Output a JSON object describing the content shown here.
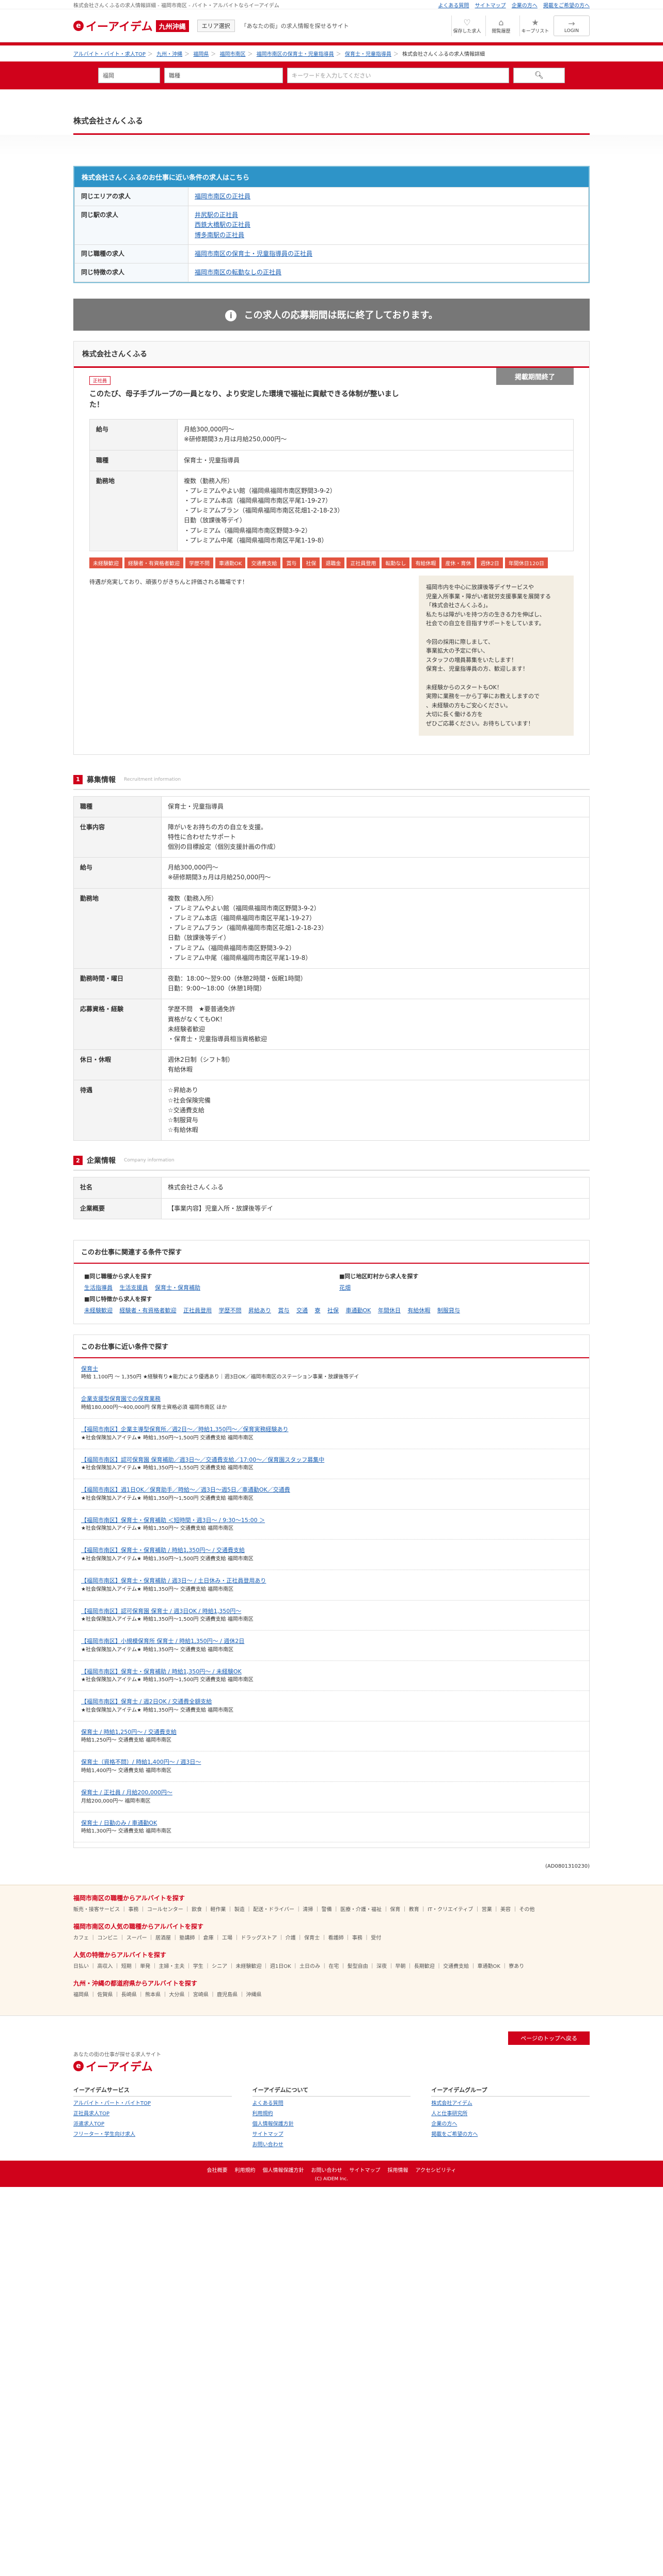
{
  "top_strip": {
    "left_text": "株式会社さんくふるの求人情報詳細 - 福岡市南区 - バイト・アルバイトならイーアイデム",
    "links": [
      "よくある質問",
      "サイトマップ",
      "企業の方へ",
      "掲載をご希望の方へ"
    ]
  },
  "header": {
    "logo_glyph": "e",
    "logo_text": "イーアイデム",
    "region": "九州沖縄",
    "area_select": "エリア選択",
    "note": "「あなたの街」の求人情報を探せるサイト",
    "icons": [
      {
        "glyph": "♡",
        "label": "保存した求人"
      },
      {
        "glyph": "⌂",
        "label": "閲覧履歴"
      },
      {
        "glyph": "★",
        "label": "キープリスト"
      },
      {
        "glyph": "→",
        "label": "LOGIN"
      }
    ]
  },
  "breadcrumb": [
    "アルバイト・バイト・求人TOP",
    "九州・沖縄",
    "福岡県",
    "福岡市南区",
    "福岡市南区の保育士・児童指導員",
    "保育士・児童指導員",
    "株式会社さんくふるの求人情報詳細"
  ],
  "search": {
    "pref": "福岡",
    "job": "職種",
    "keyword_placeholder": "キーワードを入力してください",
    "button": "検索"
  },
  "company_name": "株式会社さんくふる",
  "conditions": {
    "heading": "株式会社さんくふるのお仕事に近い条件の求人はこちら",
    "rows": [
      {
        "label": "同じエリアの求人",
        "links": [
          "福岡市南区の正社員"
        ]
      },
      {
        "label": "同じ駅の求人",
        "links": [
          "井尻駅の正社員",
          "西鉄大橋駅の正社員",
          "博多南駅の正社員"
        ]
      },
      {
        "label": "同じ職種の求人",
        "links": [
          "福岡市南区の保育士・児童指導員の正社員"
        ]
      },
      {
        "label": "同じ特徴の求人",
        "links": [
          "福岡市南区の転勤なしの正社員"
        ]
      }
    ]
  },
  "closed_banner": "この求人の応募期間は既に終了しております。",
  "job": {
    "company": "株式会社さんくふる",
    "new_badge": "正社員",
    "closed_label": "掲載期間終了",
    "catch": "このたび、母子手ブループの一員となり、より安定した環境で福祉に貢献できる体制が整いました！",
    "rows": [
      {
        "label": "給与",
        "lines": [
          "月給300,000円～",
          "※研修期間3ヵ月は月給250,000円～"
        ]
      },
      {
        "label": "職種",
        "lines": [
          "保育士・児童指導員"
        ]
      },
      {
        "label": "勤務地",
        "lines": [
          "複数（勤務入所）",
          "・プレミアムやよい館（福岡県福岡市南区野間3-9-2）",
          "・プレミアム本店（福岡県福岡市南区平尾1-19-27）",
          "・プレミアムブラン（福岡県福岡市南区花畑1-2-18-23）",
          "日勤（放課後等デイ）",
          "・プレミアム（福岡県福岡市南区野間3-9-2）",
          "・プレミアム中尾（福岡県福岡市南区平尾1-19-8）"
        ]
      }
    ],
    "tags": [
      "未経験歓迎",
      "経験者・有資格者歓迎",
      "学歴不問",
      "車通勤OK",
      "交通費支給",
      "賞与",
      "社保",
      "退職金",
      "正社員登用",
      "転勤なし",
      "有給休暇",
      "産休・育休",
      "週休2日",
      "年間休日120日"
    ],
    "promo_text": "待遇が充実しており、頑張りがきちんと評価される職場です！",
    "promo_side": [
      "福岡市内を中心に放課後等デイサービスや",
      "児童入所事業・障がい者就労支援事業を展開する",
      "「株式会社さんくふる」。",
      "私たちは障がいを持つ方の生きる力を伸ばし、",
      "社会での自立を目指すサポートをしています。",
      "",
      "今回の採用に際しまして、",
      "事業拡大の予定に伴い、",
      "スタッフの増員募集をいたします！",
      "保育士、児童指導員の方、歓迎します！",
      "",
      "未経験からのスタートもOK！",
      "実際に業務を一から丁寧にお教えしますので",
      "、未経験の方もご安心ください。",
      "大切に長く働ける方を",
      "ぜひご応募ください。お待ちしています！"
    ]
  },
  "recruit_section": {
    "num": "1",
    "title": "募集情報",
    "sub": "Recruitment information",
    "rows": [
      {
        "label": "職種",
        "lines": [
          "保育士・児童指導員"
        ]
      },
      {
        "label": "仕事内容",
        "lines": [
          "障がいをお持ちの方の自立を支援。",
          "特性に合わせたサポート",
          "個別の目標設定（個別支援計画の作成）"
        ]
      },
      {
        "label": "給与",
        "lines": [
          "月給300,000円～",
          "※研修期間3ヵ月は月給250,000円～"
        ]
      },
      {
        "label": "勤務地",
        "lines": [
          "複数（勤務入所）",
          "・プレミアムやよい館（福岡県福岡市南区野間3-9-2）",
          "・プレミアム本店（福岡県福岡市南区平尾1-19-27）",
          "・プレミアムブラン（福岡県福岡市南区花畑1-2-18-23）",
          "日勤（放課後等デイ）",
          "・プレミアム（福岡県福岡市南区野間3-9-2）",
          "・プレミアム中尾（福岡県福岡市南区平尾1-19-8）"
        ]
      },
      {
        "label": "勤務時間・曜日",
        "lines": [
          "夜勤：18:00～翌9:00（休憩2時間・仮眠1時間）",
          "日勤：9:00～18:00（休憩1時間）"
        ]
      },
      {
        "label": "応募資格・経験",
        "lines": [
          "学歴不問　★要普通免許",
          "資格がなくてもOK！",
          "未経験者歓迎",
          "・保育士・児童指導員相当資格歓迎"
        ]
      },
      {
        "label": "休日・休暇",
        "lines": [
          "週休2日制（シフト制）",
          "有給休暇"
        ]
      },
      {
        "label": "待遇",
        "lines": [
          "☆昇給あり",
          "☆社会保険完備",
          "☆交通費支給",
          "☆制服貸与",
          "☆有給休暇"
        ]
      }
    ]
  },
  "company_section": {
    "num": "2",
    "title": "企業情報",
    "sub": "Company information",
    "rows": [
      {
        "label": "社名",
        "lines": [
          "株式会社さんくふる"
        ]
      },
      {
        "label": "企業概要",
        "lines": [
          "【事業内容】児童入所・放課後等デイ"
        ]
      }
    ]
  },
  "related": {
    "title": "このお仕事に関連する条件で探す",
    "col1_label": "■同じ職種から求人を探す",
    "col1_links": [
      "生活指導員",
      "生活支援員",
      "保育士・保育補助"
    ],
    "col2_label": "■同じ地区町村から求人を探す",
    "col2_links": [
      "花畑"
    ],
    "col3_label": "■同じ特徴から求人を探す",
    "col3_links": [
      "未経験歓迎",
      "経験者・有資格者歓迎",
      "正社員登用",
      "学歴不問",
      "昇給あり",
      "賞与",
      "交通",
      "寮",
      "社保",
      "車通勤OK",
      "年間休日",
      "有給休暇",
      "制服貸与"
    ]
  },
  "nearby": {
    "title": "このお仕事に近い条件で探す",
    "items": [
      {
        "title": "保育士",
        "desc": "時給 1,100円 ～ 1,350円 ★経験有り★能力により優遇あり｜週3日OK／福岡市南区のステーション事業・放課後等デイ"
      },
      {
        "title": "企業支援型保育園での保育業務",
        "desc": "時給180,000円～400,000円 保育士資格必須 福岡市南区 ほか"
      },
      {
        "title": "【福岡市南区】企業主導型保育所／週2日～／時給1,350円～／保育実務経験あり",
        "desc": "★社会保険加入アイテム★ 時給1,350円～1,500円 交通費支給 福岡市南区"
      },
      {
        "title": "【福岡市南区】認可保育園 保育補助／週3日～／交通費支給／17:00～／保育園スタッフ募集中",
        "desc": "★社会保険加入アイテム★ 時給1,350円～1,550円 交通費支給 福岡市南区"
      },
      {
        "title": "【福岡市南区】週1日OK／保育助手／時給～／週3日～週5日／車通勤OK／交通費",
        "desc": "★社会保険加入アイテム★ 時給1,350円～1,500円 交通費支給 福岡市南区"
      },
      {
        "title": "【福岡市南区】保育士・保育補助 ＜短時間・週3日～ / 9:30～15:00 ＞",
        "desc": "★社会保険加入アイテム★ 時給1,350円～ 交通費支給 福岡市南区"
      },
      {
        "title": "【福岡市南区】保育士・保育補助 / 時給1,350円～ / 交通費支給",
        "desc": "★社会保険加入アイテム★ 時給1,350円～1,500円 交通費支給 福岡市南区"
      },
      {
        "title": "【福岡市南区】保育士・保育補助 / 週3日～ / 土日休み・正社員登用あり",
        "desc": "★社会保険加入アイテム★ 時給1,350円～ 交通費支給 福岡市南区"
      },
      {
        "title": "【福岡市南区】認可保育園 保育士 / 週3日OK / 時給1,350円～",
        "desc": "★社会保険加入アイテム★ 時給1,350円～1,500円 交通費支給 福岡市南区"
      },
      {
        "title": "【福岡市南区】小規模保育所 保育士 / 時給1,350円～ / 週休2日",
        "desc": "★社会保険加入アイテム★ 時給1,350円～ 交通費支給 福岡市南区"
      },
      {
        "title": "【福岡市南区】保育士・保育補助 / 時給1,350円～ / 未経験OK",
        "desc": "★社会保険加入アイテム★ 時給1,350円～1,500円 交通費支給 福岡市南区"
      },
      {
        "title": "【福岡市南区】保育士 / 週2日OK / 交通費全額支給",
        "desc": "★社会保険加入アイテム★ 時給1,350円～ 交通費支給 福岡市南区"
      },
      {
        "title": "保育士 / 時給1,250円～ / 交通費支給",
        "desc": "時給1,250円～ 交通費支給 福岡市南区"
      },
      {
        "title": "保育士（資格不問）/ 時給1,400円～ / 週3日～",
        "desc": "時給1,400円～ 交通費支給 福岡市南区"
      },
      {
        "title": "保育士 / 正社員 / 月給200,000円～",
        "desc": "月給200,000円～ 福岡市南区"
      },
      {
        "title": "保育士 / 日勤のみ / 車通勤OK",
        "desc": "時給1,300円～ 交通費支給 福岡市南区"
      }
    ],
    "code": "(AD0801310230)"
  },
  "area_links": [
    {
      "title": "福岡市南区の職種からアルバイトを探す",
      "text": "販売・接客サービス ｜ 事務 ｜ コールセンター ｜ 飲食 ｜ 軽作業 ｜ 製造 ｜ 配送・ドライバー ｜ 清掃 ｜ 警備 ｜ 医療・介護・福祉 ｜ 保育 ｜ 教育 ｜ IT・クリエイティブ ｜ 営業 ｜ 美容 ｜ その他"
    },
    {
      "title": "福岡市南区の人気の職種からアルバイトを探す",
      "text": "カフェ ｜ コンビニ ｜ スーパー ｜ 居酒屋 ｜ 塾講師 ｜ 倉庫 ｜ 工場 ｜ ドラッグストア ｜ 介護 ｜ 保育士 ｜ 看護師 ｜ 事務 ｜ 受付"
    },
    {
      "title": "人気の特徴からアルバイトを探す",
      "text": "日払い ｜ 高収入 ｜ 短期 ｜ 単発 ｜ 主婦・主夫 ｜ 学生 ｜ シニア ｜ 未経験歓迎 ｜ 週1日OK ｜ 土日のみ ｜ 在宅 ｜ 髪型自由 ｜ 深夜 ｜ 早朝 ｜ 長期歓迎 ｜ 交通費支給 ｜ 車通勤OK ｜ 寮あり"
    },
    {
      "title": "九州・沖縄の都道府県からアルバイトを探す",
      "text": "福岡県 ｜ 佐賀県 ｜ 長崎県 ｜ 熊本県 ｜ 大分県 ｜ 宮崎県 ｜ 鹿児島県 ｜ 沖縄県"
    }
  ],
  "pagetop": "ページのトップへ戻る",
  "footer": {
    "logo_note": "あなたの街の仕事が探せる求人サイト",
    "logo_text": "イーアイデム",
    "col1_title": "イーアイデムサービス",
    "col1": [
      "アルバイト・パート・バイトTOP",
      "正社員求人TOP",
      "派遣求人TOP",
      "フリーター・学生向け求人"
    ],
    "col2_title": "イーアイデムについて",
    "col2": [
      "よくある質問",
      "利用規約",
      "個人情報保護方針",
      "サイトマップ",
      "お問い合わせ"
    ],
    "col3_title": "イーアイデムグループ",
    "col3": [
      "株式会社アイデム",
      "人と仕事研究所",
      "企業の方へ",
      "掲載をご希望の方へ"
    ],
    "bottom_links": [
      "会社概要",
      "利用規約",
      "個人情報保護方針",
      "お問い合わせ",
      "サイトマップ",
      "採用情報",
      "アクセシビリティ"
    ],
    "copyright": "(C) AIDEM Inc."
  }
}
